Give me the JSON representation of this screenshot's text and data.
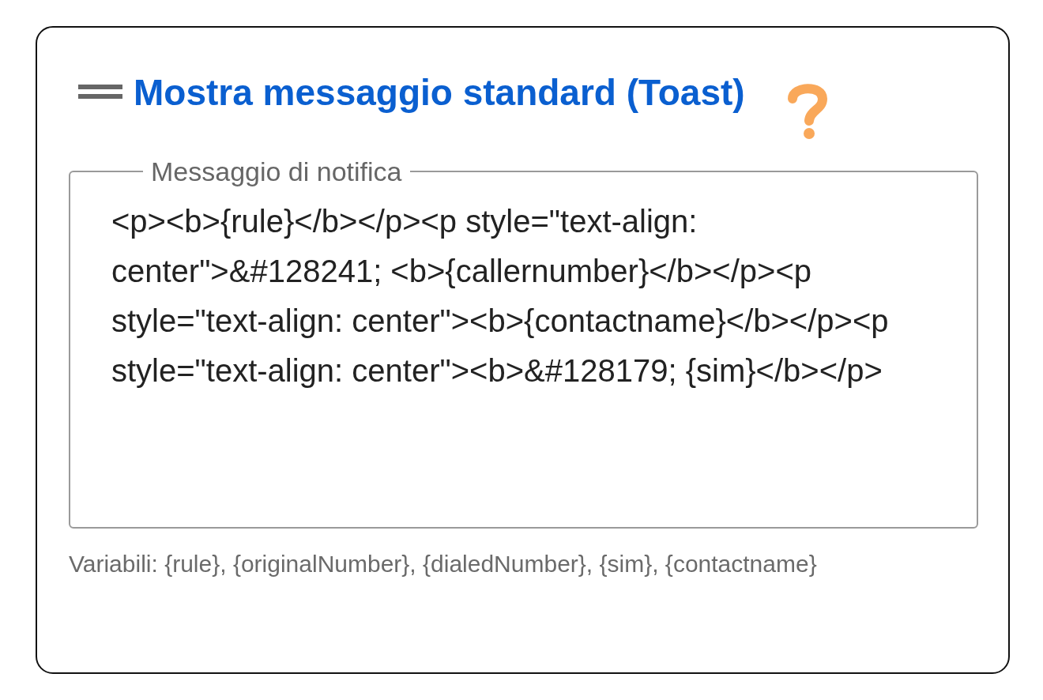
{
  "card": {
    "title": "Mostra messaggio standard (Toast)",
    "message_field": {
      "label": "Messaggio di notifica",
      "value": "<p><b>{rule}</b></p><p style=\"text-align: center\">&#128241; <b>{callernumber}</b></p><p style=\"text-align: center\"><b>{contactname}</b></p><p style=\"text-align: center\"><b>&#128179; {sim}</b></p>"
    },
    "hint": "Variabili: {rule}, {originalNumber}, {dialedNumber}, {sim}, {contactname}"
  }
}
